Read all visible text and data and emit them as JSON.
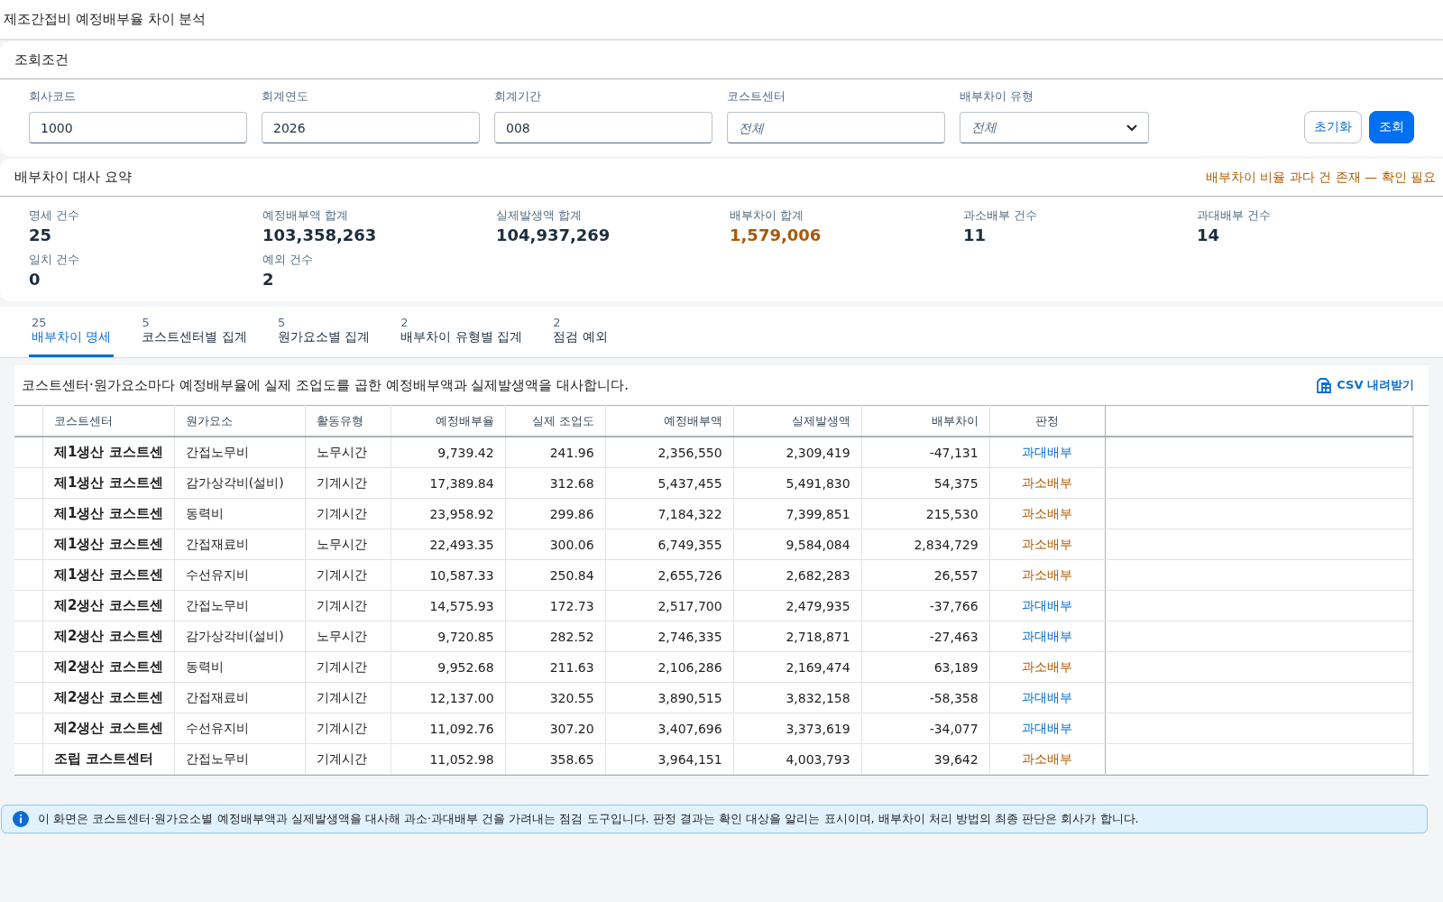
{
  "title": "제조간접비 예정배부율 차이 분석",
  "filters": {
    "heading": "조회조건",
    "fields": [
      {
        "kind": "input",
        "label": "회사코드",
        "value": "1000"
      },
      {
        "kind": "input",
        "label": "회계연도",
        "value": "2026"
      },
      {
        "kind": "input",
        "label": "회계기간",
        "value": "008"
      },
      {
        "kind": "input",
        "label": "코스트센터",
        "placeholder": "전체"
      },
      {
        "kind": "select",
        "label": "배부차이 유형",
        "placeholder": "전체"
      }
    ],
    "buttons": [
      {
        "label": "초기화",
        "kind": "secondary"
      },
      {
        "label": "조회",
        "kind": "primary"
      }
    ]
  },
  "summary": {
    "heading": "배부차이 대사 요약",
    "alert": "배부차이 비율 과다 건 존재 — 확인 필요",
    "metrics": [
      {
        "label": "명세 건수",
        "value": "25",
        "warn": false
      },
      {
        "label": "예정배부액 합계",
        "value": "103,358,263",
        "warn": false
      },
      {
        "label": "실제발생액 합계",
        "value": "104,937,269",
        "warn": false
      },
      {
        "label": "배부차이 합계",
        "value": "1,579,006",
        "warn": true
      },
      {
        "label": "과소배부 건수",
        "value": "11",
        "warn": false
      },
      {
        "label": "과대배부 건수",
        "value": "14",
        "warn": false
      },
      {
        "label": "일치 건수",
        "value": "0",
        "warn": false
      },
      {
        "label": "예외 건수",
        "value": "2",
        "warn": false
      }
    ]
  },
  "tabs": [
    {
      "count": "25",
      "label": "배부차이 명세",
      "selected": true
    },
    {
      "count": "5",
      "label": "코스트센터별 집계",
      "selected": false
    },
    {
      "count": "5",
      "label": "원가요소별 집계",
      "selected": false
    },
    {
      "count": "2",
      "label": "배부차이 유형별 집계",
      "selected": false
    },
    {
      "count": "2",
      "label": "점검 예외",
      "selected": false
    }
  ],
  "table": {
    "description": "코스트센터·원가요소마다 예정배부율에 실제 조업도를 곱한 예정배부액과 실제발생액을 대사합니다.",
    "download": "CSV 내려받기",
    "columns": [
      "코스트센터",
      "원가요소",
      "활동유형",
      "예정배부율",
      "실제 조업도",
      "예정배부액",
      "실제발생액",
      "배부차이",
      "판정"
    ],
    "rows": [
      {
        "cells": [
          "제1생산 코스트센",
          "간접노무비",
          "노무시간",
          "9,739.42",
          "241.96",
          "2,356,550",
          "2,309,419",
          "-47,131"
        ],
        "verdict": "과대배부",
        "kind": "over"
      },
      {
        "cells": [
          "제1생산 코스트센",
          "감가상각비(설비)",
          "기계시간",
          "17,389.84",
          "312.68",
          "5,437,455",
          "5,491,830",
          "54,375"
        ],
        "verdict": "과소배부",
        "kind": "under"
      },
      {
        "cells": [
          "제1생산 코스트센",
          "동력비",
          "기계시간",
          "23,958.92",
          "299.86",
          "7,184,322",
          "7,399,851",
          "215,530"
        ],
        "verdict": "과소배부",
        "kind": "under"
      },
      {
        "cells": [
          "제1생산 코스트센",
          "간접재료비",
          "노무시간",
          "22,493.35",
          "300.06",
          "6,749,355",
          "9,584,084",
          "2,834,729"
        ],
        "verdict": "과소배부",
        "kind": "under"
      },
      {
        "cells": [
          "제1생산 코스트센",
          "수선유지비",
          "기계시간",
          "10,587.33",
          "250.84",
          "2,655,726",
          "2,682,283",
          "26,557"
        ],
        "verdict": "과소배부",
        "kind": "under"
      },
      {
        "cells": [
          "제2생산 코스트센",
          "간접노무비",
          "기계시간",
          "14,575.93",
          "172.73",
          "2,517,700",
          "2,479,935",
          "-37,766"
        ],
        "verdict": "과대배부",
        "kind": "over"
      },
      {
        "cells": [
          "제2생산 코스트센",
          "감가상각비(설비)",
          "노무시간",
          "9,720.85",
          "282.52",
          "2,746,335",
          "2,718,871",
          "-27,463"
        ],
        "verdict": "과대배부",
        "kind": "over"
      },
      {
        "cells": [
          "제2생산 코스트센",
          "동력비",
          "기계시간",
          "9,952.68",
          "211.63",
          "2,106,286",
          "2,169,474",
          "63,189"
        ],
        "verdict": "과소배부",
        "kind": "under"
      },
      {
        "cells": [
          "제2생산 코스트센",
          "간접재료비",
          "기계시간",
          "12,137.00",
          "320.55",
          "3,890,515",
          "3,832,158",
          "-58,358"
        ],
        "verdict": "과대배부",
        "kind": "over"
      },
      {
        "cells": [
          "제2생산 코스트센",
          "수선유지비",
          "기계시간",
          "11,092.76",
          "307.20",
          "3,407,696",
          "3,373,619",
          "-34,077"
        ],
        "verdict": "과대배부",
        "kind": "over"
      },
      {
        "cells": [
          "조립 코스트센터",
          "간접노무비",
          "기계시간",
          "11,052.98",
          "358.65",
          "3,964,151",
          "4,003,793",
          "39,642"
        ],
        "verdict": "과소배부",
        "kind": "under"
      }
    ]
  },
  "notice": "이 화면은 코스트센터·원가요소별 예정배부액과 실제발생액을 대사해 과소·과대배부 건을 가려내는 점검 도구입니다. 판정 결과는 확인 대상을 알리는 표시이며, 배부차이 처리 방법의 최종 판단은 회사가 합니다."
}
